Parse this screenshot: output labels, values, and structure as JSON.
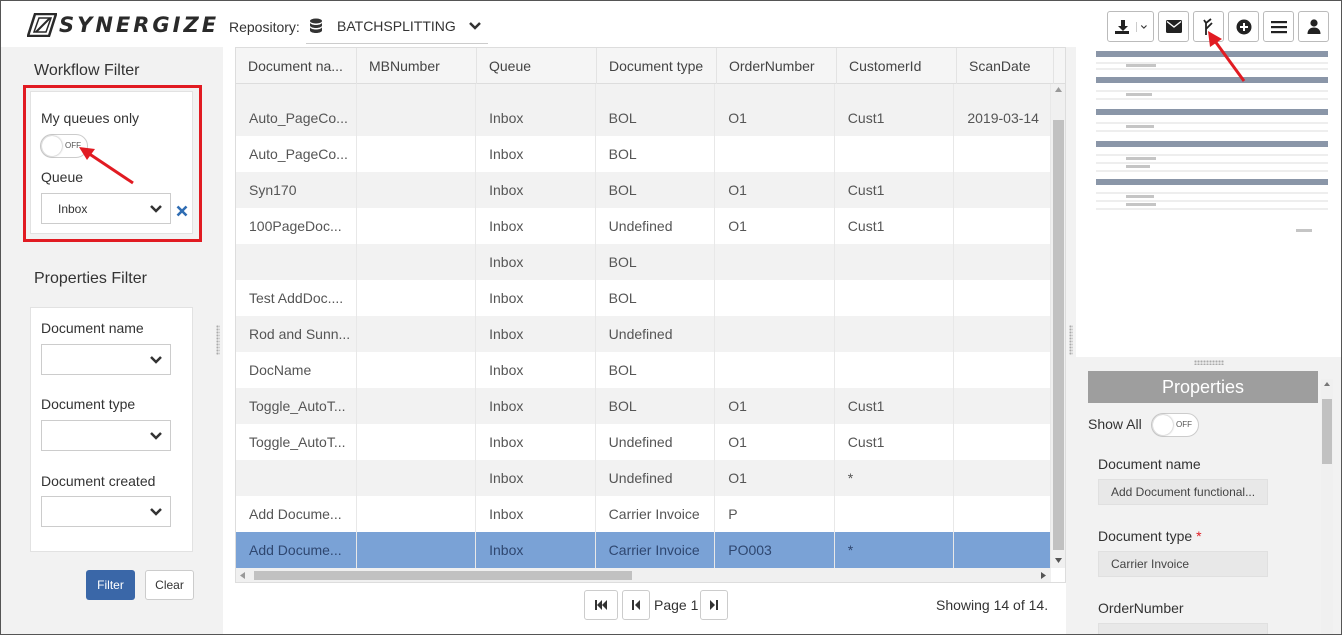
{
  "brand": {
    "name": "SYNERGIZE"
  },
  "repository": {
    "label": "Repository:",
    "value": "BATCHSPLITTING"
  },
  "toolbar": {
    "download": "download-icon",
    "email": "envelope-icon",
    "split": "split-icon",
    "add": "plus-circle-icon",
    "menu": "menu-icon",
    "user": "user-icon"
  },
  "workflow_filter": {
    "title": "Workflow Filter",
    "my_queues_label": "My queues only",
    "toggle_text": "OFF",
    "queue_label": "Queue",
    "queue_value": "Inbox"
  },
  "properties_filter": {
    "title": "Properties Filter",
    "document_name_label": "Document name",
    "document_type_label": "Document type",
    "document_created_label": "Document created",
    "filter_button": "Filter",
    "clear_button": "Clear"
  },
  "table": {
    "columns": [
      "Document na...",
      "MBNumber",
      "Queue",
      "Document type",
      "OrderNumber",
      "CustomerId",
      "ScanDate"
    ],
    "rows": [
      [
        "Auto_PageCo...",
        "",
        "Inbox",
        "BOL",
        "O1",
        "Cust1",
        "2019-03-14"
      ],
      [
        "Auto_PageCo...",
        "",
        "Inbox",
        "BOL",
        "",
        "",
        ""
      ],
      [
        "Syn170",
        "",
        "Inbox",
        "BOL",
        "O1",
        "Cust1",
        ""
      ],
      [
        "100PageDoc...",
        "",
        "Inbox",
        "Undefined",
        "O1",
        "Cust1",
        ""
      ],
      [
        "",
        "",
        "Inbox",
        "BOL",
        "",
        "",
        ""
      ],
      [
        "Test AddDoc....",
        "",
        "Inbox",
        "BOL",
        "",
        "",
        ""
      ],
      [
        "Rod and Sunn...",
        "",
        "Inbox",
        "Undefined",
        "",
        "",
        ""
      ],
      [
        "DocName",
        "",
        "Inbox",
        "BOL",
        "",
        "",
        ""
      ],
      [
        "Toggle_AutoT...",
        "",
        "Inbox",
        "BOL",
        "O1",
        "Cust1",
        ""
      ],
      [
        "Toggle_AutoT...",
        "",
        "Inbox",
        "Undefined",
        "O1",
        "Cust1",
        ""
      ],
      [
        "",
        "",
        "Inbox",
        "Undefined",
        "O1",
        "*",
        ""
      ],
      [
        "Add Docume...",
        "",
        "Inbox",
        "Carrier Invoice",
        "P",
        "",
        ""
      ],
      [
        "Add Docume...",
        "",
        "Inbox",
        "Carrier Invoice",
        "PO003",
        "*",
        ""
      ]
    ]
  },
  "pager": {
    "page_label": "Page 1",
    "showing": "Showing 14 of 14."
  },
  "properties": {
    "title": "Properties",
    "show_all_label": "Show All",
    "toggle_text": "OFF",
    "document_name_label": "Document name",
    "document_name_value": "Add Document functional...",
    "document_type_label": "Document type",
    "required_mark": "*",
    "document_type_value": "Carrier Invoice",
    "order_number_label": "OrderNumber"
  },
  "colors": {
    "accent": "#3a67a8",
    "selected_row": "#7aa2d6",
    "highlight": "#e11b22"
  }
}
